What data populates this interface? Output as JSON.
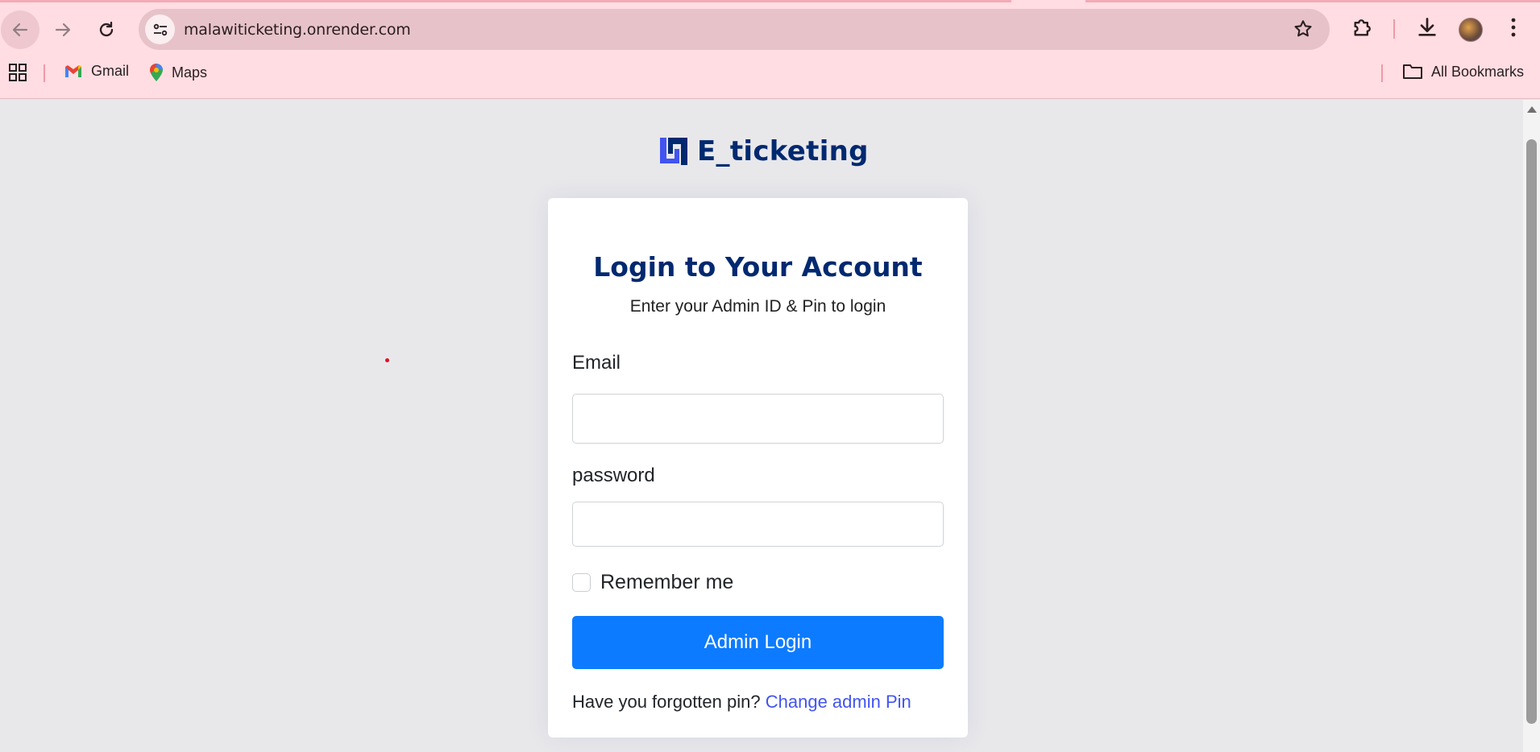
{
  "browser": {
    "url": "malawiticketing.onrender.com",
    "bookmarks": [
      {
        "label": "Gmail"
      },
      {
        "label": "Maps"
      }
    ],
    "all_bookmarks_label": "All Bookmarks"
  },
  "brand": {
    "name": "E_ticketing",
    "color": "#012970"
  },
  "login": {
    "title": "Login to Your Account",
    "subtitle": "Enter your Admin ID & Pin to login",
    "email_label": "Email",
    "email_value": "",
    "password_label": "password",
    "password_value": "",
    "remember_label": "Remember me",
    "remember_checked": false,
    "submit_label": "Admin Login",
    "forgot_text": "Have you forgotten pin?",
    "forgot_link": "Change admin Pin"
  },
  "colors": {
    "primary_button": "#0d7bff",
    "link": "#4154f1",
    "chrome_bg": "#ffdde2",
    "page_bg": "#e8e8eb"
  }
}
